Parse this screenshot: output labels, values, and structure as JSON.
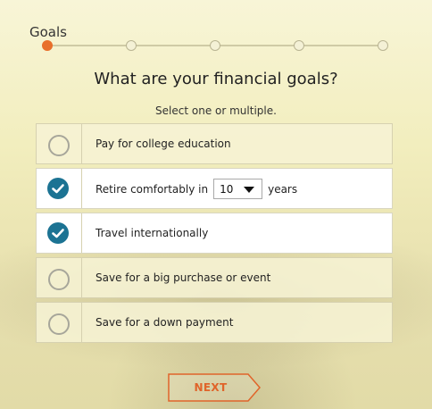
{
  "progress": {
    "current_step_label": "Goals",
    "total_steps": 5,
    "current_step": 1
  },
  "question": {
    "title": "What are your financial goals?",
    "subtitle": "Select one or multiple."
  },
  "options": [
    {
      "label": "Pay for college education",
      "checked": false
    },
    {
      "label_before": "Retire comfortably in",
      "years_value": "10",
      "label_after": "years",
      "checked": true
    },
    {
      "label": "Travel internationally",
      "checked": true
    },
    {
      "label": "Save for a big purchase or event",
      "checked": false
    },
    {
      "label": "Save for a down payment",
      "checked": false
    }
  ],
  "next_button": {
    "label": "NEXT"
  },
  "colors": {
    "accent": "#e86f2b",
    "checked": "#1c7393"
  }
}
